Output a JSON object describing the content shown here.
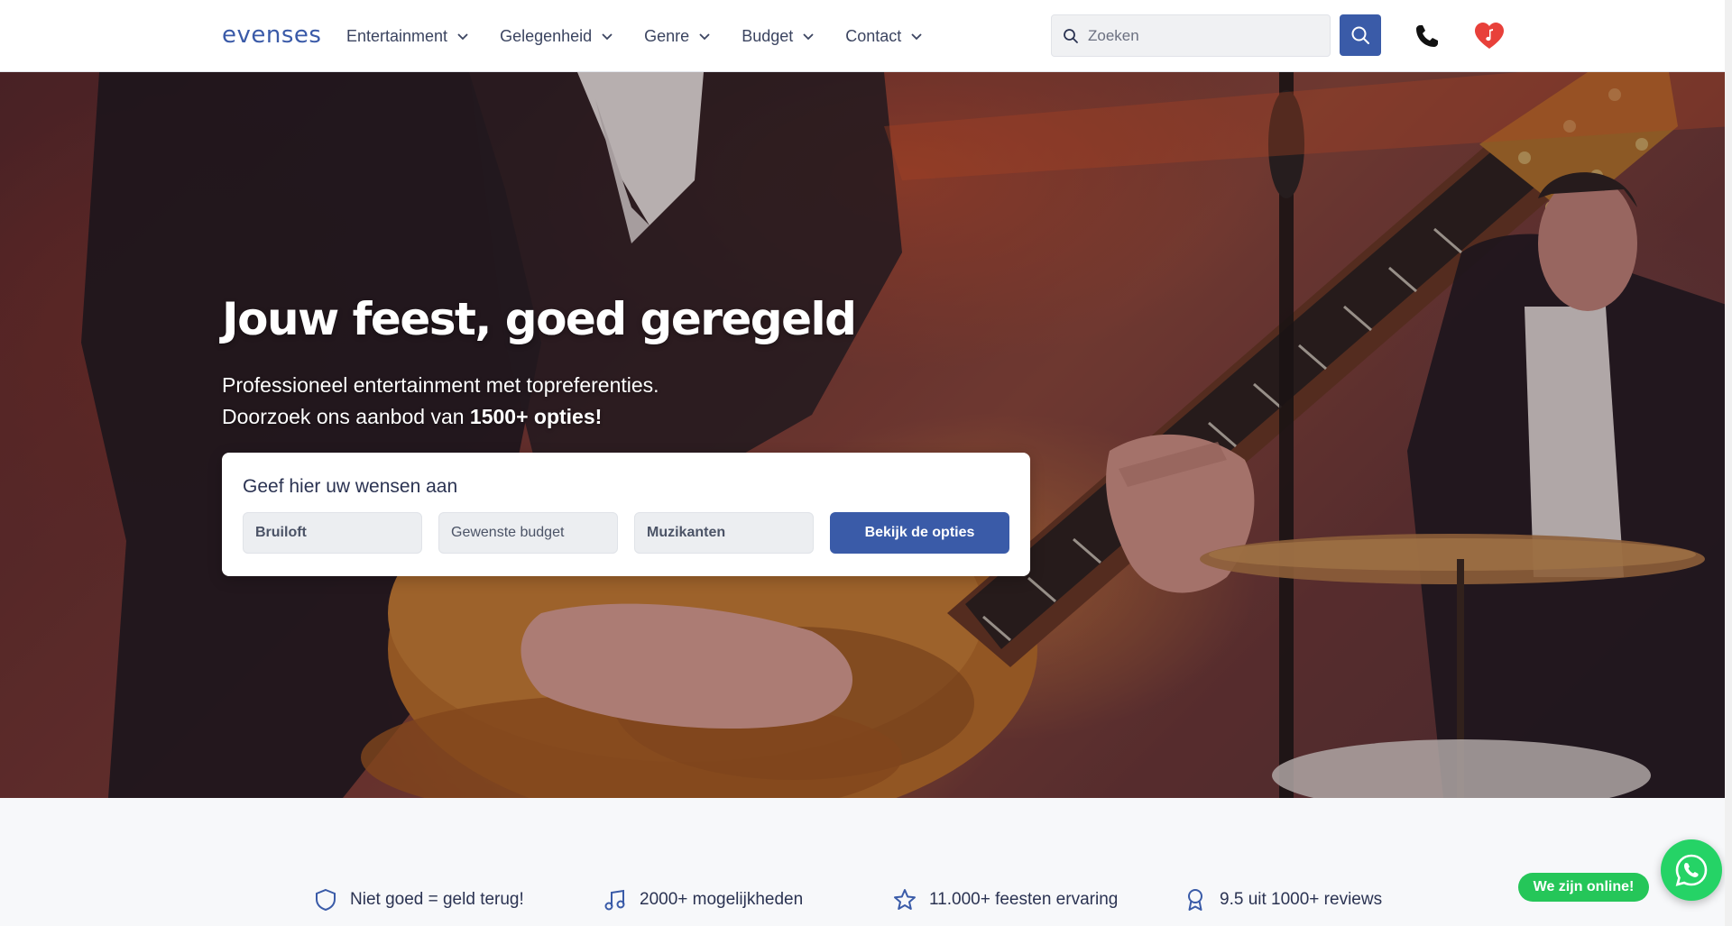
{
  "header": {
    "logo": "evenses",
    "nav": [
      {
        "label": "Entertainment"
      },
      {
        "label": "Gelegenheid"
      },
      {
        "label": "Genre"
      },
      {
        "label": "Budget"
      },
      {
        "label": "Contact"
      }
    ],
    "search": {
      "placeholder": "Zoeken",
      "value": ""
    }
  },
  "hero": {
    "title": "Jouw feest, goed geregeld",
    "subtitle_line1": "Professioneel entertainment met topreferenties.",
    "subtitle_line2_prefix": "Doorzoek ons aanbod van ",
    "subtitle_line2_bold": "1500+ opties!",
    "wish_form": {
      "title": "Geef hier uw wensen aan",
      "occasion": "Bruiloft",
      "budget_placeholder": "Gewenste budget",
      "category": "Muzikanten",
      "submit_label": "Bekijk de opties"
    }
  },
  "features": [
    {
      "icon": "shield-icon",
      "label": "Niet goed = geld terug!"
    },
    {
      "icon": "music-note-icon",
      "label": "2000+ mogelijkheden"
    },
    {
      "icon": "star-icon",
      "label": "11.000+ feesten ervaring"
    },
    {
      "icon": "award-icon",
      "label": "9.5 uit 1000+ reviews"
    }
  ],
  "chat": {
    "badge": "We zijn online!",
    "icon": "whatsapp-icon"
  },
  "colors": {
    "primary": "#3a5ba8",
    "whatsapp": "#25d366",
    "heart": "#e8403a"
  }
}
